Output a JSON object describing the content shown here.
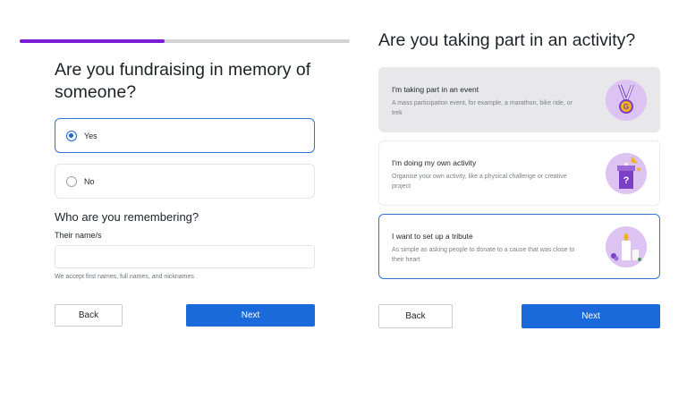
{
  "left": {
    "progress_percent": 44,
    "question": "Are you fundraising in memory of someone?",
    "options": [
      {
        "label": "Yes",
        "selected": true
      },
      {
        "label": "No",
        "selected": false
      }
    ],
    "subheading": "Who are you remembering?",
    "name_field": {
      "label": "Their name/s",
      "value": "",
      "hint": "We accept first names, full names, and nicknames"
    },
    "back_label": "Back",
    "next_label": "Next"
  },
  "right": {
    "question": "Are you taking part in an activity?",
    "activities": [
      {
        "title": "I'm taking part in an event",
        "description": "A mass participation event, for example, a marathon, bike ride, or trek",
        "icon": "medal-icon",
        "state": "hover"
      },
      {
        "title": "I'm doing my own activity",
        "description": "Organise your own activity, like a physical challenge or creative project",
        "icon": "mystery-box-icon",
        "state": "default"
      },
      {
        "title": "I want to set up a tribute",
        "description": "As simple as asking people to donate to a cause that was close to their heart",
        "icon": "candle-icon",
        "state": "selected"
      }
    ],
    "back_label": "Back",
    "next_label": "Next"
  },
  "colors": {
    "accent_blue": "#1a6adb",
    "progress_purple": "#7a1cd6",
    "illustration_lilac": "#dcc3f2"
  }
}
